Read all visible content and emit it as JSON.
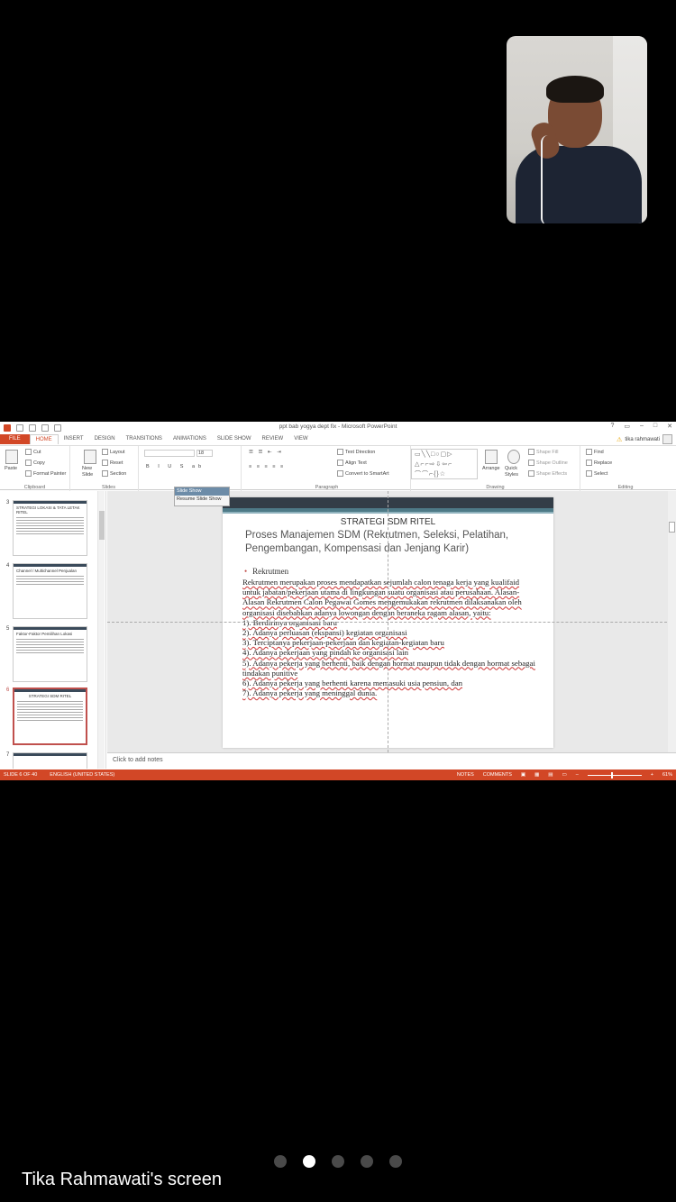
{
  "ppt": {
    "window_title": "ppt bab yogya dept fix - Microsoft PowerPoint",
    "tabs": [
      "FILE",
      "HOME",
      "INSERT",
      "DESIGN",
      "TRANSITIONS",
      "ANIMATIONS",
      "SLIDE SHOW",
      "REVIEW",
      "VIEW"
    ],
    "user_name": "tika rahmawati",
    "ribbon": {
      "clipboard": {
        "paste": "Paste",
        "cut": "Cut",
        "copy": "Copy",
        "format_painter": "Format Painter",
        "label": "Clipboard"
      },
      "slides": {
        "new_slide": "New Slide",
        "layout": "Layout",
        "reset": "Reset",
        "section": "Section",
        "label": "Slides"
      },
      "font": {
        "size": "18"
      },
      "paragraph": {
        "text_direction": "Text Direction",
        "align_text": "Align Text",
        "smartart": "Convert to SmartArt",
        "label": "Paragraph"
      },
      "drawing": {
        "arrange": "Arrange",
        "quick_styles": "Quick Styles",
        "shape_fill": "Shape Fill",
        "shape_outline": "Shape Outline",
        "shape_effects": "Shape Effects",
        "label": "Drawing"
      },
      "editing": {
        "find": "Find",
        "replace": "Replace",
        "select": "Select",
        "label": "Editing"
      }
    },
    "thumbnails": [
      {
        "num": "3",
        "title": "STRATEGI LOKASI & TATA LETAK RITEL"
      },
      {
        "num": "4",
        "title": "Channel / Multichannel Penjualan"
      },
      {
        "num": "5",
        "title": "Faktor-Faktor Pemilihan Lokasi"
      },
      {
        "num": "6",
        "title": "STRATEGI SDM RITEL"
      },
      {
        "num": "7",
        "title": ""
      }
    ],
    "popup": {
      "title": "Slide Show",
      "button": "Resume Slide Show"
    },
    "slide": {
      "title": "STRATEGI SDM RITEL",
      "subtitle": "Proses Manajemen SDM (Rekrutmen, Seleksi, Pelatihan, Pengembangan, Kompensasi dan Jenjang Karir)",
      "bullet": "Rekrutmen",
      "body": [
        "Rekrutmen merupakan proses mendapatkan sejumlah calon tenaga kerja yang kualifaid untuk jabatan/pekerjaan utama di lingkungan suatu organisasi atau perusahaan. Alasan-Alasan Rekrutmen Calon Pegawai Gomes mengemukakan rekrutmen dilaksanakan oleh organisasi disebabkan adanya lowongan dengan beraneka ragam alasan, yaitu:",
        "1). Berdirinya organisasi baru",
        "2). Adanya perluasan (ekspansi) kegiatan organisasi",
        "3). Terciptanya pekerjaan-pekerjaan dan kegiatan-kegiatan baru",
        "4). Adanya pekerjaan yang pindah ke organisasi lain",
        "5). Adanya pekerja yang berhenti, baik dengan hormat maupun tidak dengan hormat sebagai tindakan punitive",
        "6). Adanya pekerja yang berhenti karena memasuki usia pensiun, dan",
        "7).  Adanya pekerja yang meninggal dunia."
      ]
    },
    "notes_placeholder": "Click to add notes",
    "status": {
      "slide": "SLIDE 6 OF 40",
      "language": "ENGLISH (UNITED STATES)",
      "notes": "NOTES",
      "comments": "COMMENTS",
      "zoom": "61%"
    }
  },
  "meeting": {
    "screen_label": "Tika Rahmawati's screen",
    "pages": 5,
    "active_page": 2
  },
  "colors": {
    "ppt_accent": "#d24726",
    "background": "#000000"
  }
}
